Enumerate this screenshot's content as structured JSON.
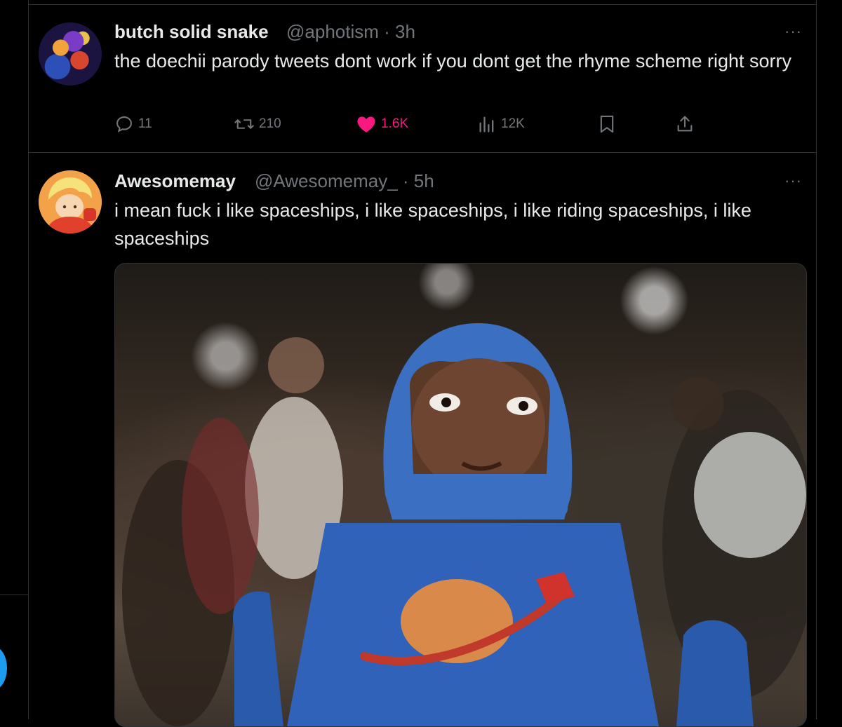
{
  "tweets": [
    {
      "display_name": "butch solid snake",
      "handle_time": "@aphotism · 3h",
      "text": "the doechii parody tweets dont work if you dont get the rhyme scheme right sorry",
      "more_label": "···",
      "actions": {
        "replies": "11",
        "reposts": "210",
        "likes": "1.6K",
        "views": "12K"
      }
    },
    {
      "display_name": "Awesomemay",
      "handle_time": "@Awesomemay_ · 5h",
      "text": "i mean fuck i like spaceships, i like spaceships, i like riding spaceships, i like spaceships",
      "more_label": "···"
    }
  ],
  "colors": {
    "accent": "#1d9bf0",
    "like": "#f91880",
    "muted": "#71767b",
    "text": "#e7e9ea",
    "background": "#000000"
  },
  "icons": [
    "reply-icon",
    "repost-icon",
    "heart-icon",
    "views-icon",
    "bookmark-icon",
    "share-icon",
    "more-icon"
  ]
}
